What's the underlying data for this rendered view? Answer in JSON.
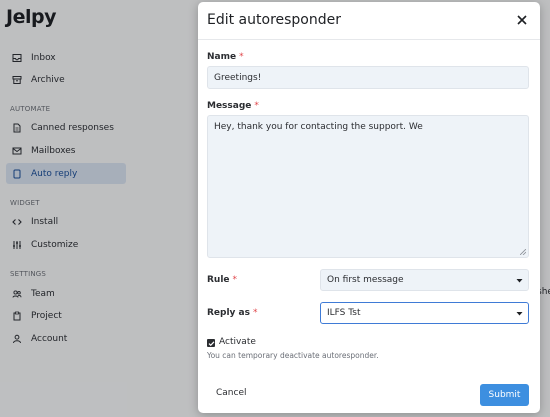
{
  "app": {
    "logo": "Jelpy"
  },
  "sidebar": {
    "items_top": [
      {
        "label": "Inbox",
        "icon": "inbox-icon"
      },
      {
        "label": "Archive",
        "icon": "archive-icon"
      }
    ],
    "section_automate": "AUTOMATE",
    "items_automate": [
      {
        "label": "Canned responses",
        "icon": "document-icon"
      },
      {
        "label": "Mailboxes",
        "icon": "mailbox-icon"
      },
      {
        "label": "Auto reply",
        "icon": "autoreply-icon",
        "active": true
      }
    ],
    "section_widget": "WIDGET",
    "items_widget": [
      {
        "label": "Install",
        "icon": "code-icon"
      },
      {
        "label": "Customize",
        "icon": "sliders-icon"
      }
    ],
    "section_settings": "SETTINGS",
    "items_settings": [
      {
        "label": "Team",
        "icon": "team-icon"
      },
      {
        "label": "Project",
        "icon": "clipboard-icon"
      },
      {
        "label": "Account",
        "icon": "user-icon"
      }
    ]
  },
  "background_fragment": "she",
  "modal": {
    "title": "Edit autoresponder",
    "name_label": "Name",
    "name_value": "Greetings!",
    "message_label": "Message",
    "message_value": "Hey, thank you for contacting the support. We",
    "rule_label": "Rule",
    "rule_value": "On first message",
    "reply_as_label": "Reply as",
    "reply_as_value": "ILFS Tst",
    "required_mark": "*",
    "activate_label": "Activate",
    "activate_checked": true,
    "activate_hint": "You can temporary deactivate autoresponder.",
    "cancel_label": "Cancel",
    "submit_label": "Submit"
  },
  "colors": {
    "accent": "#3d8fe0",
    "active_nav_bg": "#d7e1ef",
    "required": "#e0464a",
    "focus_border": "#3f7bd6"
  }
}
